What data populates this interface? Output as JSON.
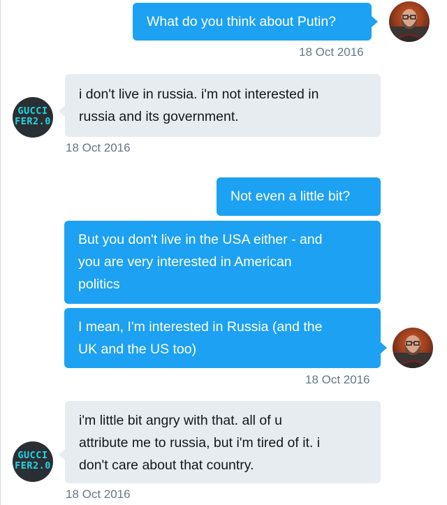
{
  "conversation": {
    "messages": [
      {
        "sender": "user",
        "lines": [
          "What do you think about Putin?"
        ],
        "timestamp": "18 Oct 2016"
      },
      {
        "sender": "guccifer",
        "lines": [
          "i don't live in russia. i'm not interested in",
          "russia and its government."
        ],
        "timestamp": "18 Oct 2016"
      },
      {
        "sender": "user",
        "lines": [
          "Not even a little bit?"
        ]
      },
      {
        "sender": "user",
        "lines": [
          "But you don't live in the USA either - and",
          "you are very interested in American",
          "politics"
        ]
      },
      {
        "sender": "user",
        "lines": [
          "I mean, I'm interested in Russia (and the",
          "UK and the US too)"
        ],
        "timestamp": "18 Oct 2016"
      },
      {
        "sender": "guccifer",
        "lines": [
          "i'm little bit angry with that. all of u",
          "attribute me to russia, but i'm tired of it. i",
          "don't care about that country."
        ],
        "timestamp": "18 Oct 2016"
      }
    ]
  },
  "avatars": {
    "guccifer": {
      "line1": "GUCCI",
      "line2": "FER2.0"
    }
  },
  "colors": {
    "outgoing_bubble": "#1da1f2",
    "incoming_bubble": "#e6ecf0",
    "timestamp": "#657786",
    "guccifer_avatar_bg": "#2a2f33",
    "guccifer_avatar_text": "#24d4e4"
  },
  "icons": {
    "user_avatar": "bearded-man-avatar",
    "guccifer_avatar": "guccifer-text-logo-avatar"
  }
}
